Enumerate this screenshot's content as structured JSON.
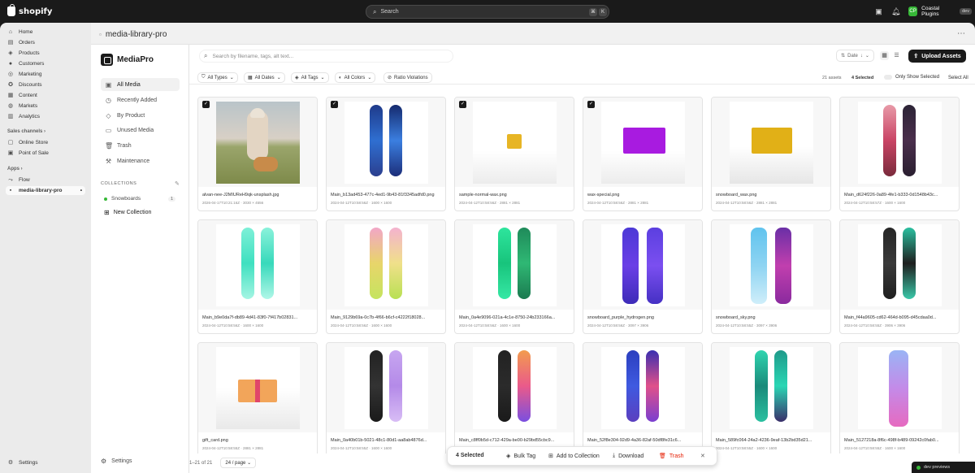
{
  "topbar": {
    "brand": "shopify",
    "search_placeholder": "Search",
    "kbd1": "⌘",
    "kbd2": "K",
    "store_initials": "CP",
    "store_name": "Coastal Plugins",
    "dev_badge": "dev"
  },
  "nav": {
    "items": [
      {
        "label": "Home",
        "icon": "home-icon"
      },
      {
        "label": "Orders",
        "icon": "orders-icon"
      },
      {
        "label": "Products",
        "icon": "tag-icon"
      },
      {
        "label": "Customers",
        "icon": "person-icon"
      },
      {
        "label": "Marketing",
        "icon": "target-icon"
      },
      {
        "label": "Discounts",
        "icon": "discount-icon"
      },
      {
        "label": "Content",
        "icon": "content-icon"
      },
      {
        "label": "Markets",
        "icon": "globe-icon"
      },
      {
        "label": "Analytics",
        "icon": "chart-icon"
      }
    ],
    "sales_channels_label": "Sales channels",
    "sales_channels": [
      {
        "label": "Online Store"
      },
      {
        "label": "Point of Sale"
      }
    ],
    "apps_label": "Apps",
    "apps": [
      {
        "label": "Flow"
      },
      {
        "label": "media-library-pro"
      }
    ],
    "settings_label": "Settings"
  },
  "page": {
    "title": "media-library-pro"
  },
  "app": {
    "brand_name": "MediaPro",
    "sidebar": [
      {
        "label": "All Media",
        "icon": "media-icon",
        "active": true
      },
      {
        "label": "Recently Added",
        "icon": "clock-icon"
      },
      {
        "label": "By Product",
        "icon": "product-icon"
      },
      {
        "label": "Unused Media",
        "icon": "image-icon"
      },
      {
        "label": "Trash",
        "icon": "trash-icon"
      },
      {
        "label": "Maintenance",
        "icon": "wrench-icon"
      }
    ],
    "collections_heading": "COLLECTIONS",
    "collection": {
      "label": "Snowboards",
      "count": "1"
    },
    "new_collection": "New Collection",
    "settings": "Settings",
    "search_placeholder": "Search by filename, tags, alt text...",
    "sort_label": "Date",
    "upload_label": "Upload Assets",
    "filters": [
      "All Types",
      "All Dates",
      "All Tags",
      "All Colors",
      "Ratio Violations"
    ],
    "asset_count": "21 assets",
    "selected_count": "4 Selected",
    "only_show_selected": "Only Show Selected",
    "select_all": "Select All",
    "pagination_range": "1–21 of 21",
    "per_page": "24 / page"
  },
  "assets": [
    {
      "name": "alvan-nee-J2MIUReH9qk-unsplash.jpg",
      "meta": "2026-04-17T10:21:16Z · 3030 × 4556",
      "selected": true
    },
    {
      "name": "Main_b13ad453-477c-4ed1-9b43-81f3345adfd0.png",
      "meta": "2024-04-12T10:58:56Z · 1600 × 1600",
      "selected": true
    },
    {
      "name": "sample-normal-wax.png",
      "meta": "2024-04-12T10:58:56Z · 2881 × 2881",
      "selected": true
    },
    {
      "name": "wax-special.png",
      "meta": "2024-04-12T10:58:56Z · 2881 × 2881",
      "selected": true
    },
    {
      "name": "snowboard_wax.png",
      "meta": "2024-04-12T10:58:56Z · 2881 × 2881",
      "selected": false
    },
    {
      "name": "Main_d624f226-0a89-4fe1-b333-0d1548b43c...",
      "meta": "2024-04-12T10:58:57Z · 1600 × 1600",
      "selected": false
    },
    {
      "name": "Main_b9e0da7f-db89-4d41-83f0-7f417b02831...",
      "meta": "2024-04-12T10:58:56Z · 1600 × 1600",
      "selected": false
    },
    {
      "name": "Main_9129b69a-0c7b-4f66-b6cf-c4222f18028...",
      "meta": "2024-04-12T10:58:56Z · 1600 × 1600",
      "selected": false
    },
    {
      "name": "Main_0a4e9096-021a-4c1e-8750-24b233166a...",
      "meta": "2024-04-12T10:58:56Z · 1600 × 1600",
      "selected": false
    },
    {
      "name": "snowboard_purple_hydrogen.png",
      "meta": "2024-04-12T10:58:56Z · 3097 × 3906",
      "selected": false
    },
    {
      "name": "snowboard_sky.png",
      "meta": "2024-04-12T10:58:55Z · 3097 × 3906",
      "selected": false
    },
    {
      "name": "Main_f44a9605-cd62-464d-b095-d45cdaa0d...",
      "meta": "2024-04-12T10:58:55Z · 3906 × 3906",
      "selected": false
    },
    {
      "name": "gift_card.png",
      "meta": "2024-04-12T10:58:55Z · 2881 × 2881",
      "selected": false
    },
    {
      "name": "Main_0a40b01b-5021-48c1-80d1-aa8ab4876d...",
      "meta": "2024-04-12T10:58:55Z · 1600 × 1600",
      "selected": false
    },
    {
      "name": "Main_c8ff0b5d-c712-429a-be00-b29bd55cbc9...",
      "meta": "2024-04-12T10:58:55Z · 1600 × 1600",
      "selected": false
    },
    {
      "name": "Main_52f8e304-92d9-4a36-82af-50df8fe31c6...",
      "meta": "2024-04-12T10:58:55Z · 1600 × 1600",
      "selected": false
    },
    {
      "name": "Main_589fc064-24a2-4236-9eaf-13b2bd35d21...",
      "meta": "2024-04-12T10:58:55Z · 1600 × 1600",
      "selected": false
    },
    {
      "name": "Main_5127218a-8f6c-498f-b489-09242c0fab0...",
      "meta": "2024-04-12T10:58:55Z · 1600 × 1600",
      "selected": false
    }
  ],
  "action_bar": {
    "selected": "4 Selected",
    "bulk_tag": "Bulk Tag",
    "add_to_collection": "Add to Collection",
    "download": "Download",
    "trash": "Trash"
  },
  "dev_previews": "dev previews",
  "colors": {
    "accent": "#1a1a1a",
    "danger": "#e51c00",
    "success": "#36b837"
  }
}
